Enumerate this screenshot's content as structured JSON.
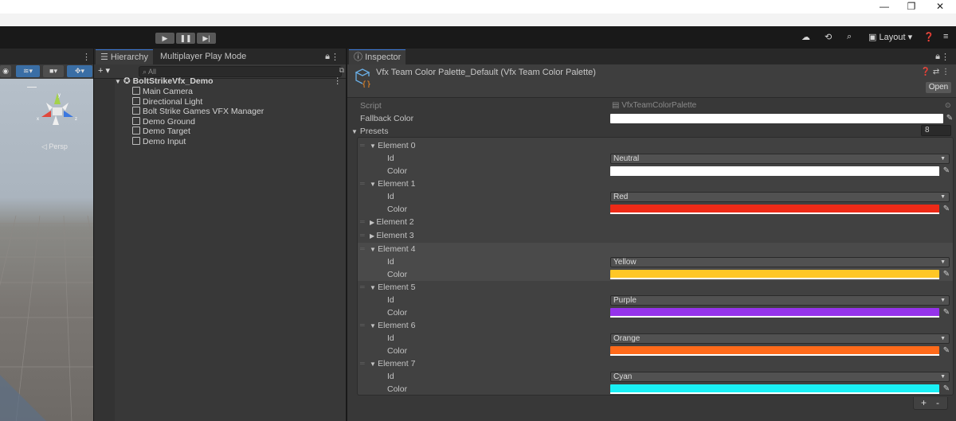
{
  "window": {
    "minimize": "—",
    "restore": "❐",
    "close": "✕"
  },
  "toolbar": {
    "play": "▶",
    "pause": "❚❚",
    "step": "▶|",
    "layout_label": "Layout"
  },
  "scene": {
    "persp_label": "◁ Persp"
  },
  "hierarchy": {
    "tab_label": "Hierarchy",
    "tab2_label": "Multiplayer Play Mode",
    "add_label": "+ ▾",
    "search_placeholder": "All",
    "root": "BoltStrikeVfx_Demo",
    "items": [
      "Main Camera",
      "Directional Light",
      "Bolt Strike Games VFX Manager",
      "Demo Ground",
      "Demo Target",
      "Demo Input"
    ]
  },
  "inspector": {
    "tab_label": "Inspector",
    "title": "Vfx Team Color Palette_Default (Vfx Team Color Palette)",
    "open_label": "Open",
    "script_label": "Script",
    "script_value": "VfxTeamColorPalette",
    "fallback_label": "Fallback Color",
    "fallback_color": "#ffffff",
    "presets_label": "Presets",
    "presets_count": "8",
    "id_label": "Id",
    "color_label": "Color",
    "elements": [
      {
        "label": "Element 0",
        "expanded": true,
        "id": "Neutral",
        "color": "#ffffff"
      },
      {
        "label": "Element 1",
        "expanded": true,
        "id": "Red",
        "color": "#ee2a17"
      },
      {
        "label": "Element 2",
        "expanded": false
      },
      {
        "label": "Element 3",
        "expanded": false
      },
      {
        "label": "Element 4",
        "expanded": true,
        "id": "Yellow",
        "color": "#ffc726"
      },
      {
        "label": "Element 5",
        "expanded": true,
        "id": "Purple",
        "color": "#9533ea"
      },
      {
        "label": "Element 6",
        "expanded": true,
        "id": "Orange",
        "color": "#ff6a1a"
      },
      {
        "label": "Element 7",
        "expanded": true,
        "id": "Cyan",
        "color": "#19f0f5"
      }
    ],
    "add_btn": "+",
    "remove_btn": "-"
  }
}
